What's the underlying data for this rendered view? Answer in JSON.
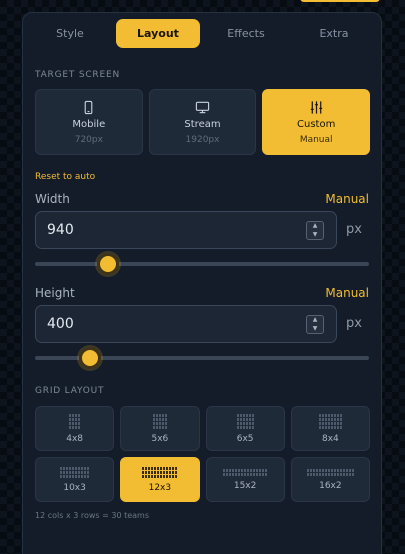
{
  "tabs": [
    {
      "label": "Style",
      "active": false
    },
    {
      "label": "Layout",
      "active": true
    },
    {
      "label": "Effects",
      "active": false
    },
    {
      "label": "Extra",
      "active": false
    }
  ],
  "target_screen": {
    "title": "TARGET SCREEN",
    "options": [
      {
        "name": "Mobile",
        "sub": "720px",
        "icon": "phone-icon",
        "active": false
      },
      {
        "name": "Stream",
        "sub": "1920px",
        "icon": "monitor-icon",
        "active": false
      },
      {
        "name": "Custom",
        "sub": "Manual",
        "icon": "sliders-icon",
        "active": true
      }
    ],
    "reset_label": "Reset to auto"
  },
  "width": {
    "label": "Width",
    "mode": "Manual",
    "value": "940",
    "unit": "px",
    "slider_fraction": 0.22
  },
  "height": {
    "label": "Height",
    "mode": "Manual",
    "value": "400",
    "unit": "px",
    "slider_fraction": 0.165
  },
  "grid_layout": {
    "title": "GRID LAYOUT",
    "options": [
      {
        "label": "4x8",
        "cols": 4,
        "rows": 8,
        "active": false
      },
      {
        "label": "5x6",
        "cols": 5,
        "rows": 6,
        "active": false
      },
      {
        "label": "6x5",
        "cols": 6,
        "rows": 5,
        "active": false
      },
      {
        "label": "8x4",
        "cols": 8,
        "rows": 4,
        "active": false
      },
      {
        "label": "10x3",
        "cols": 10,
        "rows": 3,
        "active": false
      },
      {
        "label": "12x3",
        "cols": 12,
        "rows": 3,
        "active": true
      },
      {
        "label": "15x2",
        "cols": 15,
        "rows": 2,
        "active": false
      },
      {
        "label": "16x2",
        "cols": 16,
        "rows": 2,
        "active": false
      }
    ],
    "summary": "12 cols x 3 rows = 30 teams"
  },
  "colors": {
    "accent": "#f2bd32",
    "panel": "#131c28",
    "button": "#1f2a39"
  }
}
